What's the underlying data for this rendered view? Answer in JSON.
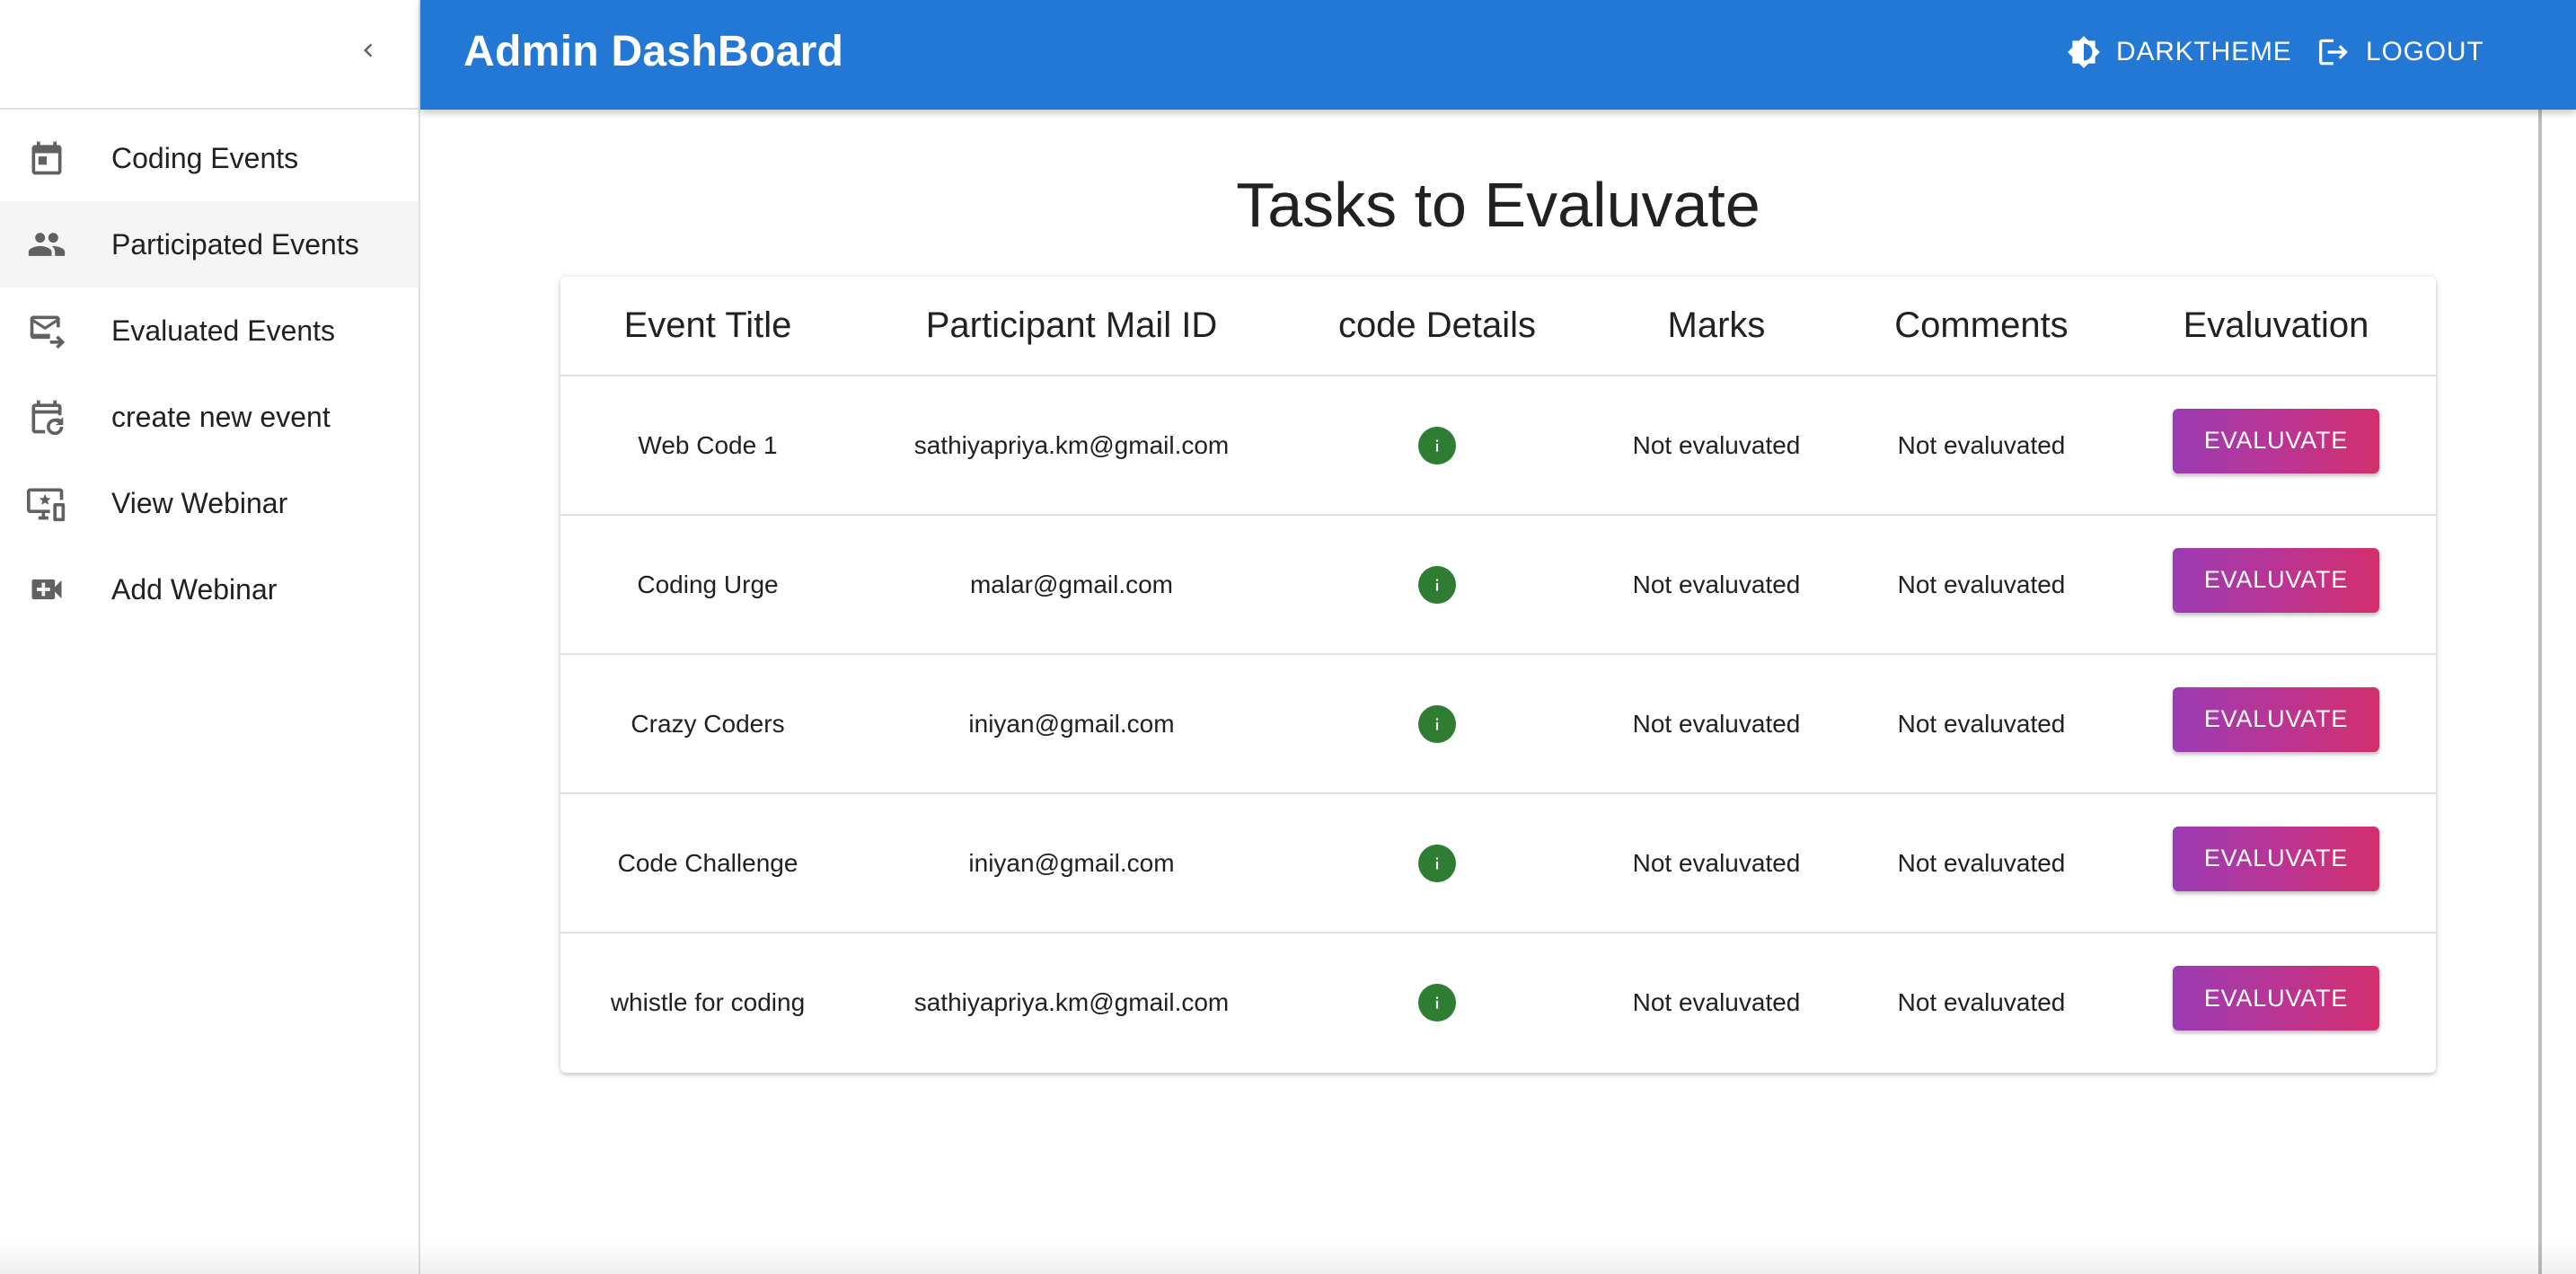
{
  "app": {
    "title": "Admin DashBoard",
    "theme_label": "DARKTHEME",
    "logout_label": "LOGOUT",
    "accent_color": "#2278d4"
  },
  "sidebar": {
    "collapse_icon": "chevron-left-icon",
    "items": [
      {
        "label": "Coding Events",
        "icon": "calendar-icon",
        "active": false
      },
      {
        "label": "Participated Events",
        "icon": "people-icon",
        "active": true
      },
      {
        "label": "Evaluated Events",
        "icon": "mail-forward-icon",
        "active": false
      },
      {
        "label": "create new event",
        "icon": "calendar-refresh-icon",
        "active": false
      },
      {
        "label": "View Webinar",
        "icon": "monitor-star-icon",
        "active": false
      },
      {
        "label": "Add Webinar",
        "icon": "video-add-icon",
        "active": false
      }
    ]
  },
  "main": {
    "title": "Tasks to Evaluvate",
    "table": {
      "headers": [
        "Event Title",
        "Participant Mail ID",
        "code Details",
        "Marks",
        "Comments",
        "Evaluvation"
      ],
      "rows": [
        {
          "event": "Web Code 1",
          "mail": "sathiyapriya.km@gmail.com",
          "marks": "Not evaluvated",
          "comments": "Not evaluvated",
          "action": "EVALUVATE"
        },
        {
          "event": "Coding Urge",
          "mail": "malar@gmail.com",
          "marks": "Not evaluvated",
          "comments": "Not evaluvated",
          "action": "EVALUVATE"
        },
        {
          "event": "Crazy Coders",
          "mail": "iniyan@gmail.com",
          "marks": "Not evaluvated",
          "comments": "Not evaluvated",
          "action": "EVALUVATE"
        },
        {
          "event": "Code Challenge",
          "mail": "iniyan@gmail.com",
          "marks": "Not evaluvated",
          "comments": "Not evaluvated",
          "action": "EVALUVATE"
        },
        {
          "event": "whistle for coding",
          "mail": "sathiyapriya.km@gmail.com",
          "marks": "Not evaluvated",
          "comments": "Not evaluvated",
          "action": "EVALUVATE"
        }
      ],
      "info_icon_color": "#2e7d32",
      "button_gradient": [
        "#9b3bb3",
        "#d32f6d"
      ]
    }
  }
}
